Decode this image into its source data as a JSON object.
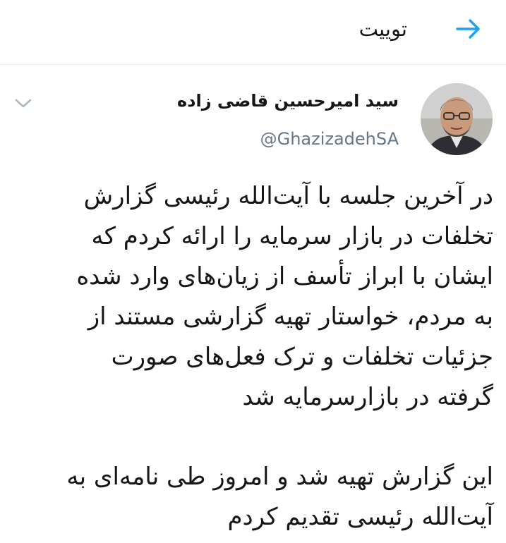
{
  "header": {
    "title": "توییت",
    "back_icon": "arrow-right-icon",
    "accent_color": "#1da1f2"
  },
  "tweet": {
    "author_name": "سید امیرحسین قاضی زاده",
    "author_handle": "@GhazizadehSA",
    "menu_icon": "chevron-down-icon",
    "paragraphs": [
      [
        "در آخرین جلسه با آیت‌الله رئیسی گزارش",
        "تخلفات در بازار سرمایه را ارائه کردم که",
        "ایشان با ابراز تأسف از زیان‌های وارد شده",
        "به مردم، خواستار تهیه گزارشی مستند از",
        "جزئیات تخلفات و ترک فعل‌های صورت",
        "گرفته در بازارسرمایه شد"
      ],
      [
        "این گزارش تهیه شد و امروز طی نامه‌ای به",
        "آیت‌الله رئیسی تقدیم کردم"
      ]
    ]
  }
}
